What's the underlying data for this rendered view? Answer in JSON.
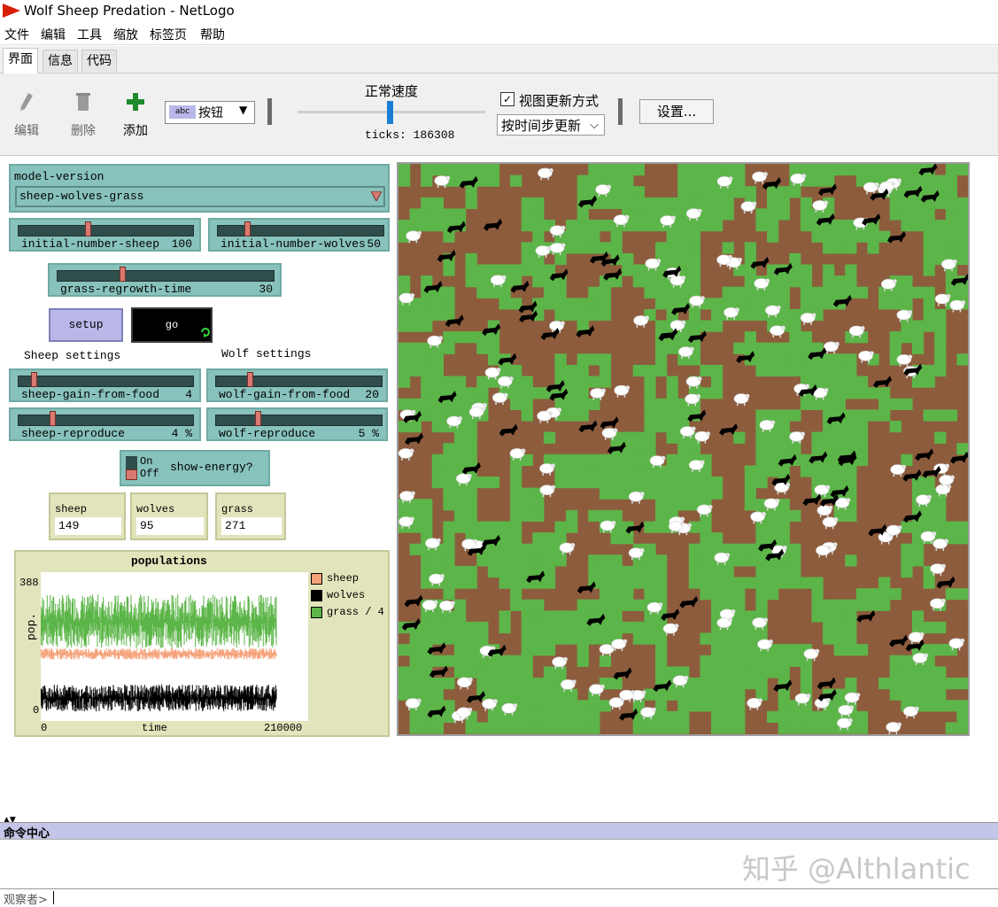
{
  "window": {
    "title": "Wolf Sheep Predation - NetLogo"
  },
  "menu": [
    "文件",
    "编辑",
    "工具",
    "缩放",
    "标签页",
    "帮助"
  ],
  "tabs": [
    "界面",
    "信息",
    "代码"
  ],
  "toolbar": {
    "edit": "编辑",
    "delete": "删除",
    "add": "添加",
    "widget_type": "按钮",
    "widget_type_icon": "abc",
    "speed_label": "正常速度",
    "speed_level": 0.49,
    "ticks_label": "ticks:",
    "ticks_value": "186308",
    "view_updates_label": "视图更新方式",
    "view_updates_checked": true,
    "update_mode": "按时间步更新",
    "settings": "设置..."
  },
  "interface": {
    "chooser": {
      "name": "model-version",
      "value": "sheep-wolves-grass"
    },
    "sliders": {
      "initial_number_sheep": {
        "name": "initial-number-sheep",
        "value": "100",
        "fraction": 0.4
      },
      "initial_number_wolves": {
        "name": "initial-number-wolves",
        "value": "50",
        "fraction": 0.17
      },
      "grass_regrowth_time": {
        "name": "grass-regrowth-time",
        "value": "30",
        "fraction": 0.3
      },
      "sheep_gain_from_food": {
        "name": "sheep-gain-from-food",
        "value": "4",
        "fraction": 0.08
      },
      "wolf_gain_from_food": {
        "name": "wolf-gain-from-food",
        "value": "20",
        "fraction": 0.2
      },
      "sheep_reproduce": {
        "name": "sheep-reproduce",
        "value": "4 %",
        "fraction": 0.19
      },
      "wolf_reproduce": {
        "name": "wolf-reproduce",
        "value": "5 %",
        "fraction": 0.25
      }
    },
    "setup_label": "setup",
    "go_label": "go",
    "sheep_settings_label": "Sheep settings",
    "wolf_settings_label": "Wolf settings",
    "switch": {
      "on": "On",
      "off": "Off",
      "name": "show-energy?"
    },
    "monitors": [
      {
        "name": "sheep",
        "value": "149"
      },
      {
        "name": "wolves",
        "value": "95"
      },
      {
        "name": "grass",
        "value": "271"
      }
    ]
  },
  "chart_data": {
    "type": "line",
    "title": "populations",
    "xlabel": "time",
    "ylabel": "pop.",
    "xlim": [
      0,
      210000
    ],
    "ylim": [
      0,
      388
    ],
    "x_ticks": [
      "0",
      "210000"
    ],
    "y_ticks": [
      "388",
      "0"
    ],
    "legend_position": "right",
    "series": [
      {
        "name": "sheep",
        "color": "#f5a27a",
        "range": [
          160,
          190
        ]
      },
      {
        "name": "wolves",
        "color": "#000000",
        "range": [
          25,
          95
        ]
      },
      {
        "name": "grass / 4",
        "color": "#5cb548",
        "range": [
          190,
          330
        ]
      }
    ]
  },
  "world": {
    "grass_color": "#5cb548",
    "dirt_color": "#8d5c3d"
  },
  "command_center": {
    "title": "命令中心",
    "prompt": "观察者>"
  },
  "watermark": "知乎 @Althlantic",
  "colors": {
    "slider_bg": "#88c2bc",
    "monitor_bg": "#e2e4bb",
    "button_bg": "#b9b8e8"
  }
}
